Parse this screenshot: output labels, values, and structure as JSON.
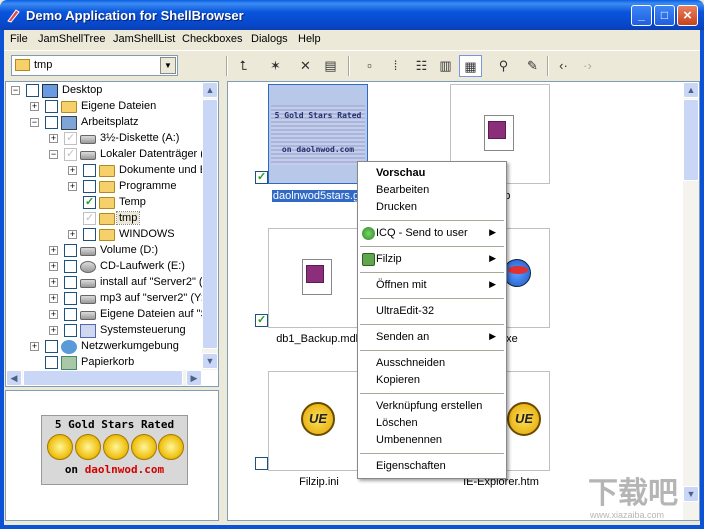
{
  "window": {
    "title": "Demo Application for ShellBrowser"
  },
  "menubar": {
    "items": [
      "File",
      "JamShellTree",
      "JamShellList",
      "Checkboxes",
      "Dialogs",
      "Help"
    ]
  },
  "toolbar": {
    "path_value": "tmp",
    "buttons": [
      "up-folder",
      "new-folder",
      "delete",
      "properties",
      "large-icons",
      "small-icons",
      "list",
      "details",
      "thumbnails",
      "search",
      "new-item",
      "back",
      "forward"
    ]
  },
  "tree": {
    "items": [
      {
        "label": "Desktop"
      },
      {
        "label": "Eigene Dateien"
      },
      {
        "label": "Arbeitsplatz"
      },
      {
        "label": "3½-Diskette (A:)"
      },
      {
        "label": "Lokaler Datenträger ("
      },
      {
        "label": "Dokumente und E"
      },
      {
        "label": "Programme"
      },
      {
        "label": "Temp"
      },
      {
        "label": "tmp"
      },
      {
        "label": "WINDOWS"
      },
      {
        "label": "Volume (D:)"
      },
      {
        "label": "CD-Laufwerk (E:)"
      },
      {
        "label": "install auf \"Server2\" ("
      },
      {
        "label": "mp3 auf \"server2\" (Y:"
      },
      {
        "label": "Eigene Dateien auf \"S"
      },
      {
        "label": "Systemsteuerung"
      },
      {
        "label": "Netzwerkumgebung"
      },
      {
        "label": "Papierkorb"
      }
    ]
  },
  "ad": {
    "line1": "5 Gold Stars Rated",
    "line2_prefix": "on",
    "line2_site": "daolnwod.com"
  },
  "files": [
    {
      "name": "daolnwod5stars.g",
      "banner_top": "5 Gold Stars Rated",
      "banner_bottom": "on daolnwod.com"
    },
    {
      "name": "ndb"
    },
    {
      "name": "db1_Backup.mdb"
    },
    {
      "name": "exe"
    },
    {
      "name": "Filzip.ini"
    },
    {
      "name": "IE-Explorer.htm"
    }
  ],
  "context_menu": {
    "items": [
      {
        "label": "Vorschau"
      },
      {
        "label": "Bearbeiten"
      },
      {
        "label": "Drucken"
      },
      {
        "label": "ICQ - Send to user"
      },
      {
        "label": "Filzip"
      },
      {
        "label": "Öffnen mit"
      },
      {
        "label": "UltraEdit-32"
      },
      {
        "label": "Senden an"
      },
      {
        "label": "Ausschneiden"
      },
      {
        "label": "Kopieren"
      },
      {
        "label": "Verknüpfung erstellen"
      },
      {
        "label": "Löschen"
      },
      {
        "label": "Umbenennen"
      },
      {
        "label": "Eigenschaften"
      }
    ]
  },
  "watermark": {
    "big": "下载吧",
    "small": "www.xiazaiba.com"
  }
}
